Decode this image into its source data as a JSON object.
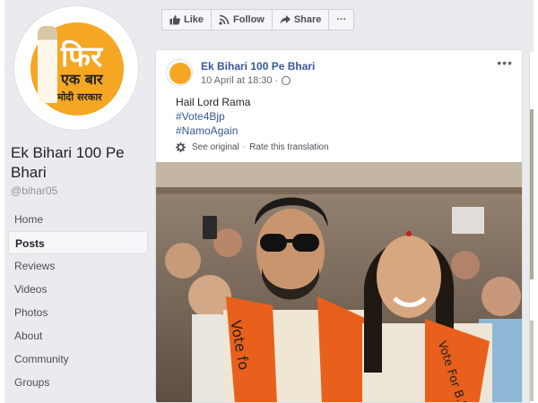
{
  "page": {
    "profile_logo": {
      "line1": "फिर",
      "line2": "एक बार",
      "line3": "मोदी सरकार"
    },
    "name": "Ek Bihari 100 Pe Bhari",
    "handle": "@bihar05"
  },
  "nav": {
    "items": [
      {
        "label": "Home"
      },
      {
        "label": "Posts"
      },
      {
        "label": "Reviews"
      },
      {
        "label": "Videos"
      },
      {
        "label": "Photos"
      },
      {
        "label": "About"
      },
      {
        "label": "Community"
      },
      {
        "label": "Groups"
      }
    ],
    "active": "Posts"
  },
  "actions": {
    "like_label": "Like",
    "follow_label": "Follow",
    "share_label": "Share",
    "more_label": "···"
  },
  "post": {
    "author": "Ek Bihari 100 Pe Bhari",
    "timestamp": "10 April at 18:30 ·",
    "more_label": "•••",
    "text_line": "Hail Lord Rama",
    "hashtags": [
      "#Vote4Bjp",
      "#NamoAgain"
    ],
    "see_original": "See original",
    "separator": "·",
    "rate_translation": "Rate this translation",
    "photo": {
      "left_banner_text": "Vote fo",
      "right_banner_text": "Vote For B.J."
    }
  },
  "colors": {
    "link": "#365899",
    "page_bg": "#e9ebee",
    "saffron": "#f5a623",
    "banner_orange": "#e8601c"
  }
}
